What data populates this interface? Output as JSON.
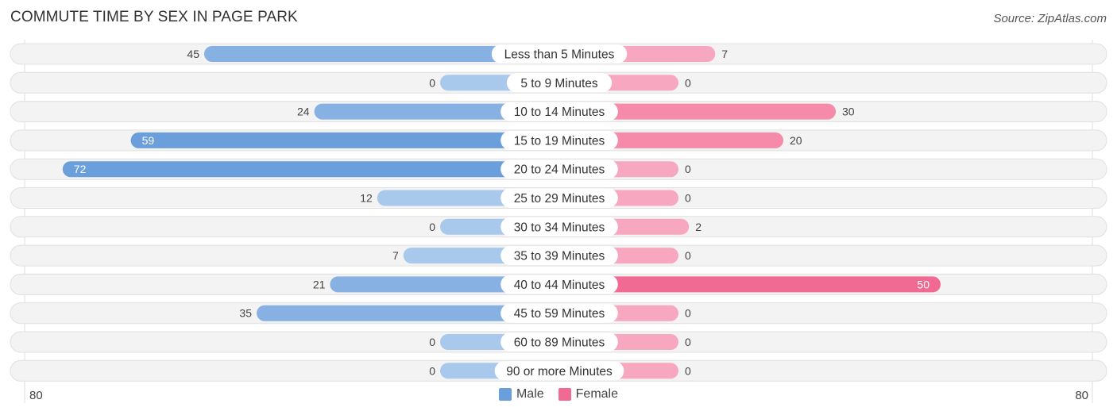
{
  "title": "COMMUTE TIME BY SEX IN PAGE PARK",
  "source": "Source: ZipAtlas.com",
  "colors": {
    "male_strong": "#6a9fdc",
    "male_light": "#a8c8ec",
    "female_strong": "#f06a94",
    "female_light": "#f7a8c0",
    "row_bg": "#f3f3f3"
  },
  "chart_data": {
    "type": "bar",
    "orientation": "horizontal-diverging",
    "title": "COMMUTE TIME BY SEX IN PAGE PARK",
    "categories": [
      "Less than 5 Minutes",
      "5 to 9 Minutes",
      "10 to 14 Minutes",
      "15 to 19 Minutes",
      "20 to 24 Minutes",
      "25 to 29 Minutes",
      "30 to 34 Minutes",
      "35 to 39 Minutes",
      "40 to 44 Minutes",
      "45 to 59 Minutes",
      "60 to 89 Minutes",
      "90 or more Minutes"
    ],
    "series": [
      {
        "name": "Male",
        "values": [
          45,
          0,
          24,
          59,
          72,
          12,
          0,
          7,
          21,
          35,
          0,
          0
        ]
      },
      {
        "name": "Female",
        "values": [
          7,
          0,
          30,
          20,
          0,
          0,
          2,
          0,
          50,
          0,
          0,
          0
        ]
      }
    ],
    "axis_range": [
      80,
      80
    ],
    "axis_left_label": "80",
    "axis_right_label": "80",
    "legend": [
      "Male",
      "Female"
    ],
    "legend_position": "bottom-center"
  }
}
